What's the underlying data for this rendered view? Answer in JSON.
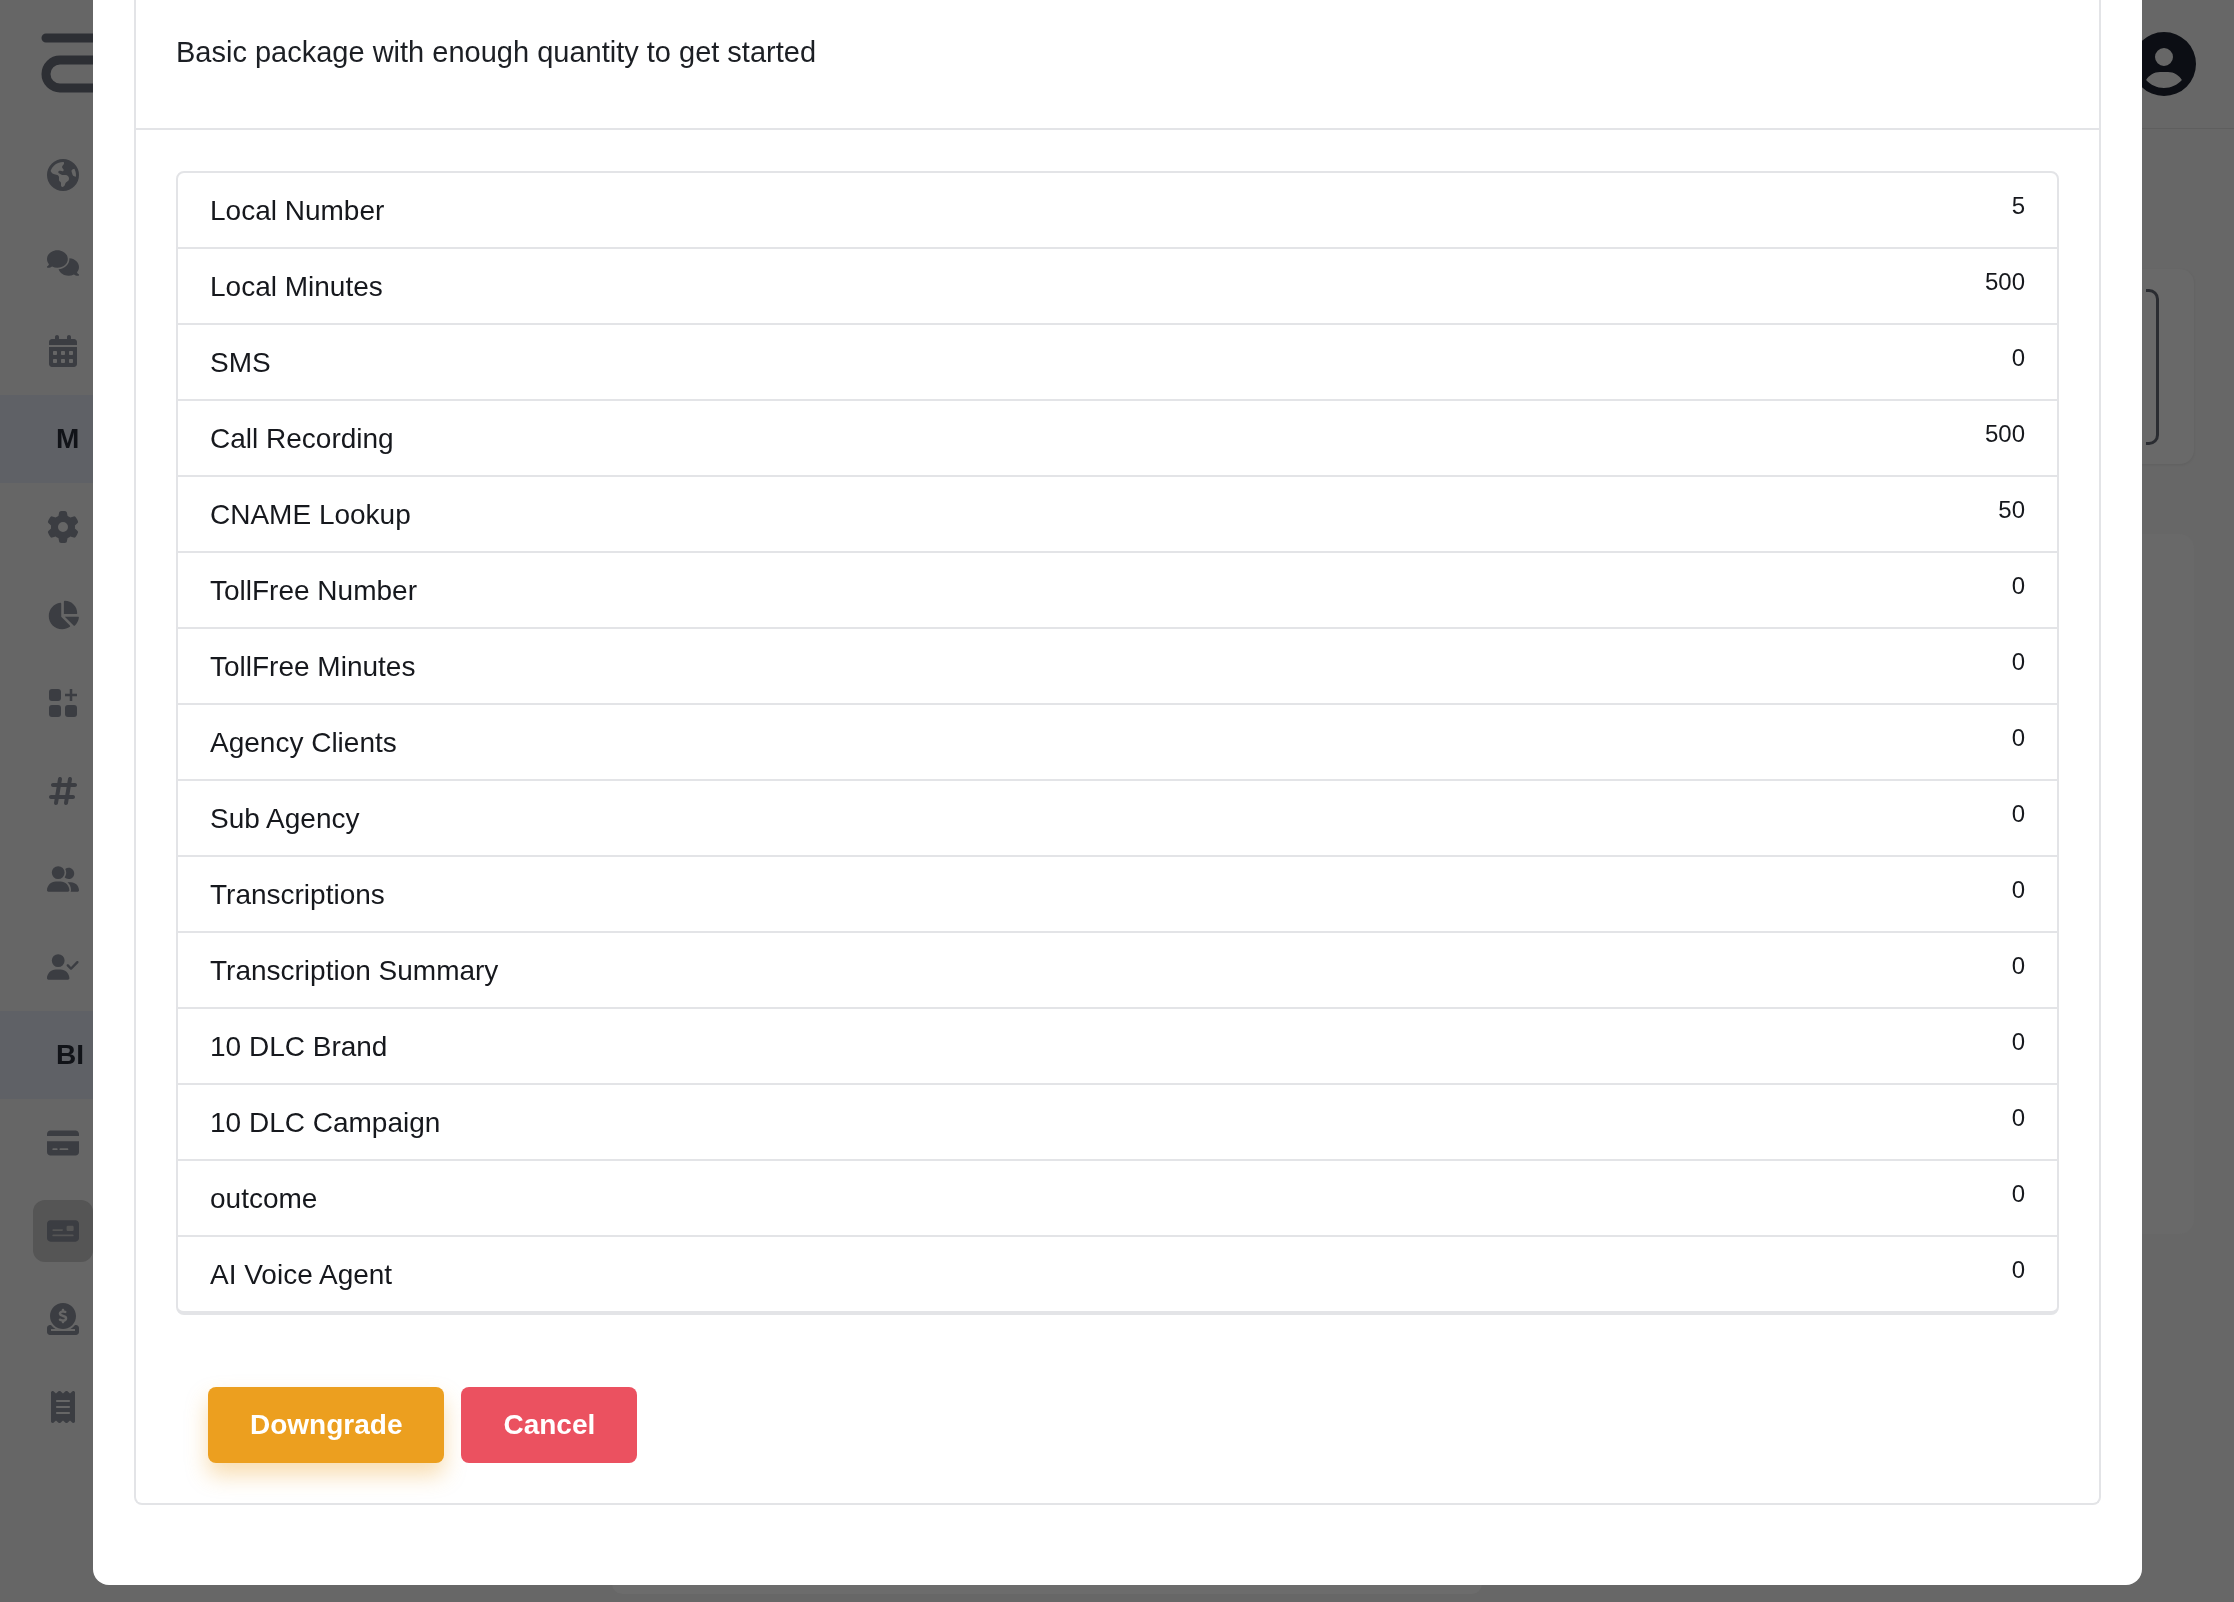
{
  "sidebar": {
    "items": [
      {
        "kind": "icon",
        "selected": false
      },
      {
        "kind": "icon",
        "selected": false
      },
      {
        "kind": "icon",
        "selected": false
      },
      {
        "kind": "section",
        "label": "M"
      },
      {
        "kind": "icon",
        "selected": false
      },
      {
        "kind": "icon",
        "selected": false
      },
      {
        "kind": "icon",
        "selected": false
      },
      {
        "kind": "icon",
        "selected": false
      },
      {
        "kind": "icon",
        "selected": false
      },
      {
        "kind": "icon",
        "selected": false
      },
      {
        "kind": "section",
        "label": "BI"
      },
      {
        "kind": "icon",
        "selected": false
      },
      {
        "kind": "icon",
        "selected": true
      },
      {
        "kind": "icon",
        "selected": false
      },
      {
        "kind": "icon",
        "selected": false
      }
    ]
  },
  "modal": {
    "description": "Basic package with enough quantity to get started",
    "items": [
      {
        "label": "Local Number",
        "value": "5"
      },
      {
        "label": "Local Minutes",
        "value": "500"
      },
      {
        "label": "SMS",
        "value": "0"
      },
      {
        "label": "Call Recording",
        "value": "500"
      },
      {
        "label": "CNAME Lookup",
        "value": "50"
      },
      {
        "label": "TollFree Number",
        "value": "0"
      },
      {
        "label": "TollFree Minutes",
        "value": "0"
      },
      {
        "label": "Agency Clients",
        "value": "0"
      },
      {
        "label": "Sub Agency",
        "value": "0"
      },
      {
        "label": "Transcriptions",
        "value": "0"
      },
      {
        "label": "Transcription Summary",
        "value": "0"
      },
      {
        "label": "10 DLC Brand",
        "value": "0"
      },
      {
        "label": "10 DLC Campaign",
        "value": "0"
      },
      {
        "label": "outcome",
        "value": "0"
      },
      {
        "label": "AI Voice Agent",
        "value": "0"
      }
    ],
    "buttons": [
      {
        "label": "Downgrade",
        "kind": "warning"
      },
      {
        "label": "Cancel",
        "kind": "danger"
      }
    ]
  }
}
